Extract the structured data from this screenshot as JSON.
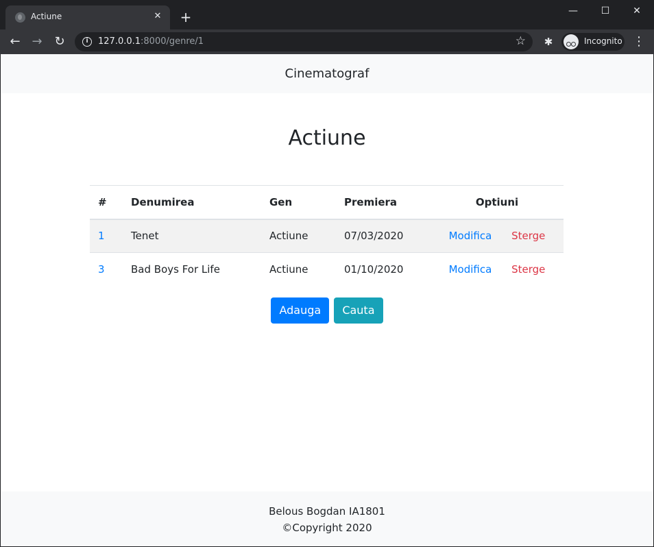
{
  "browser": {
    "tab_title": "Actiune",
    "tab_close": "✕",
    "new_tab": "+",
    "url_host": "127.0.0.1",
    "url_rest": ":8000/genre/1",
    "incognito_label": "Incognito",
    "window_controls": {
      "minimize": "—",
      "maximize": "☐",
      "close": "✕"
    },
    "icons": [
      "back-icon",
      "forward-icon",
      "reload-icon",
      "info-icon",
      "star-icon",
      "extensions-icon",
      "incognito-icon",
      "menu-icon"
    ]
  },
  "navbar": {
    "brand": "Cinematograf"
  },
  "page": {
    "title": "Actiune"
  },
  "table": {
    "headers": [
      "#",
      "Denumirea",
      "Gen",
      "Premiera",
      "Optiuni"
    ],
    "rows": [
      {
        "id": "1",
        "name": "Tenet",
        "genre": "Actiune",
        "premiere": "07/03/2020",
        "edit": "Modifica",
        "delete": "Sterge"
      },
      {
        "id": "3",
        "name": "Bad Boys For Life",
        "genre": "Actiune",
        "premiere": "01/10/2020",
        "edit": "Modifica",
        "delete": "Sterge"
      }
    ]
  },
  "actions": {
    "add_label": "Adauga",
    "search_label": "Cauta"
  },
  "footer": {
    "author": "Belous Bogdan IA1801",
    "copyright": "©Copyright 2020"
  },
  "colors": {
    "primary": "#007bff",
    "info": "#17a2b8",
    "danger": "#dc3545",
    "chrome_dark": "#202124",
    "chrome_mid": "#35363a"
  }
}
